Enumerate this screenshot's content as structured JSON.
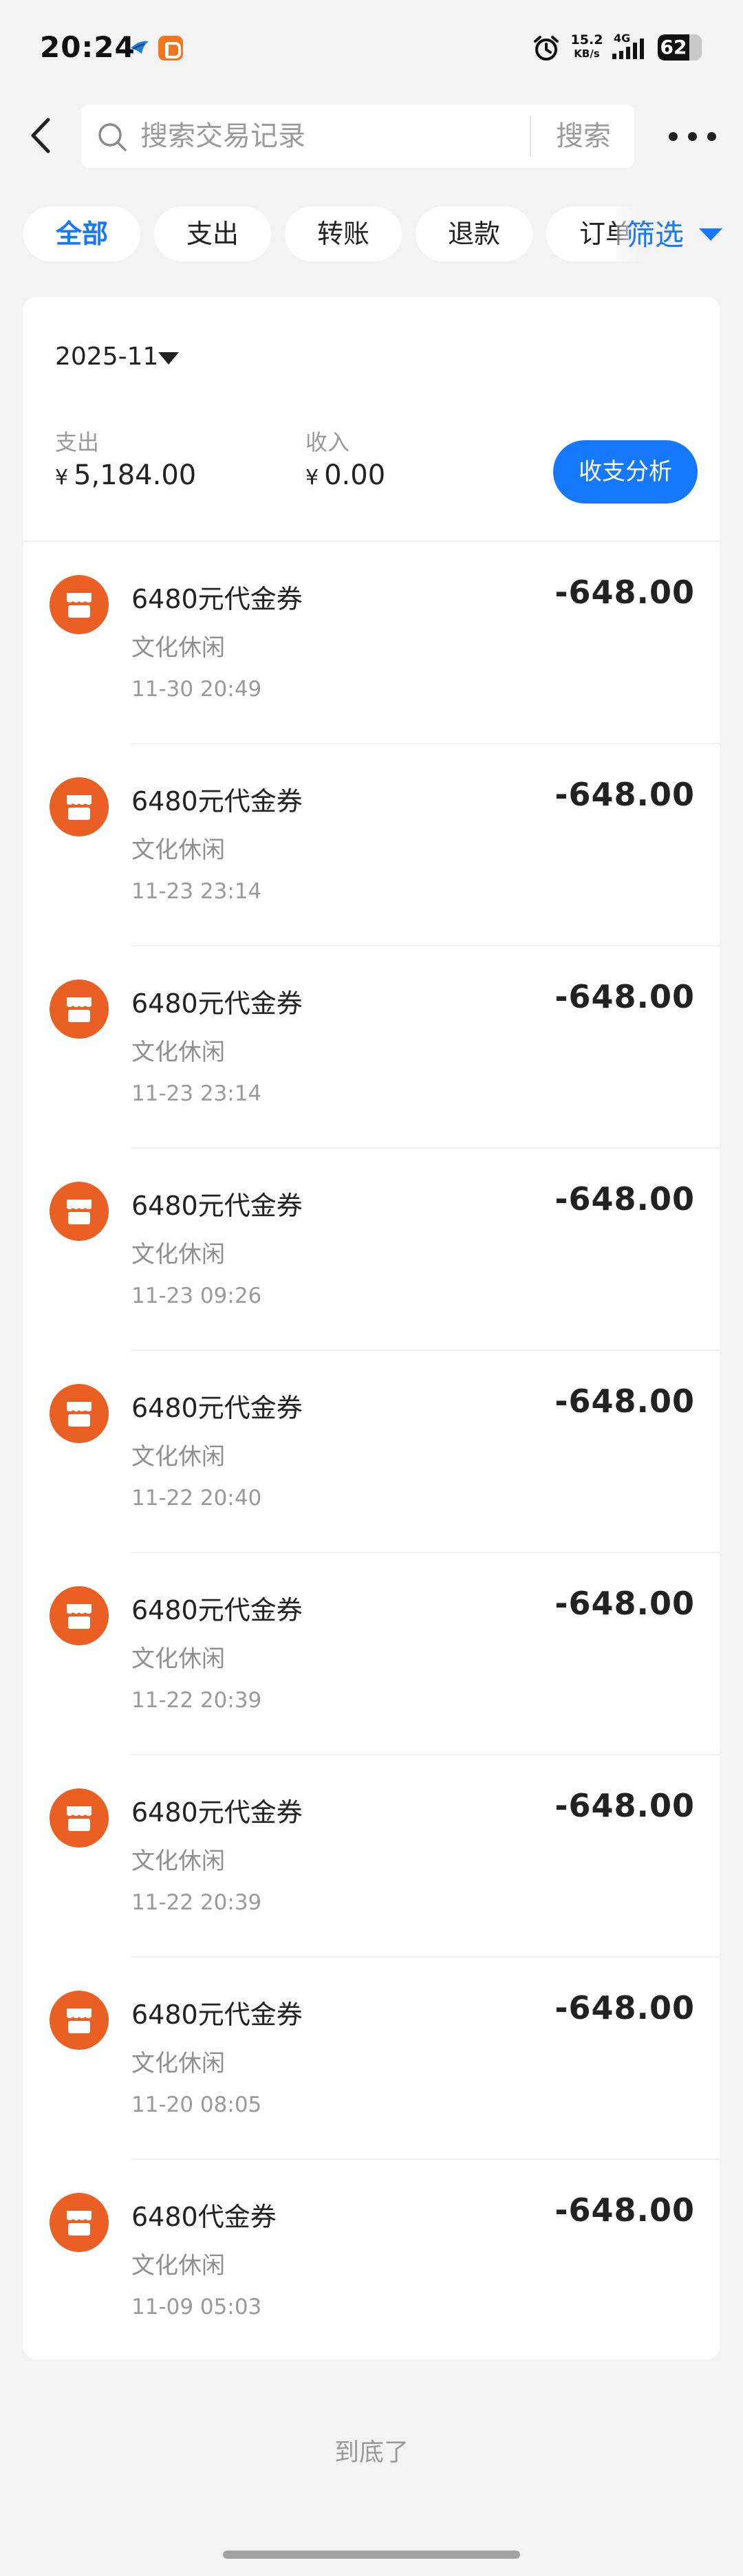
{
  "status_bar": {
    "time": "20:24",
    "net_speed_value": "15.2",
    "net_speed_unit": "KB/s",
    "network": "4G",
    "battery": "62"
  },
  "header": {
    "search_placeholder": "搜索交易记录",
    "search_button": "搜索"
  },
  "chips": [
    {
      "label": "全部",
      "active": true
    },
    {
      "label": "支出"
    },
    {
      "label": "转账"
    },
    {
      "label": "退款"
    },
    {
      "label": "订单"
    }
  ],
  "filter": {
    "label": "筛选"
  },
  "summary": {
    "month": "2025-11",
    "expense_label": "支出",
    "currency": "¥",
    "expense_value": "5,184.00",
    "income_label": "收入",
    "income_value": "0.00",
    "analysis_button": "收支分析"
  },
  "transactions": [
    {
      "title": "6480元代金券",
      "category": "文化休闲",
      "time": "11-30 20:49",
      "amount": "-648.00"
    },
    {
      "title": "6480元代金券",
      "category": "文化休闲",
      "time": "11-23 23:14",
      "amount": "-648.00"
    },
    {
      "title": "6480元代金券",
      "category": "文化休闲",
      "time": "11-23 23:14",
      "amount": "-648.00"
    },
    {
      "title": "6480元代金券",
      "category": "文化休闲",
      "time": "11-23 09:26",
      "amount": "-648.00"
    },
    {
      "title": "6480元代金券",
      "category": "文化休闲",
      "time": "11-22 20:40",
      "amount": "-648.00"
    },
    {
      "title": "6480元代金券",
      "category": "文化休闲",
      "time": "11-22 20:39",
      "amount": "-648.00"
    },
    {
      "title": "6480元代金券",
      "category": "文化休闲",
      "time": "11-22 20:39",
      "amount": "-648.00"
    },
    {
      "title": "6480元代金券",
      "category": "文化休闲",
      "time": "11-20 08:05",
      "amount": "-648.00"
    },
    {
      "title": "6480代金券",
      "category": "文化休闲",
      "time": "11-09 05:03",
      "amount": "-648.00"
    }
  ],
  "footer": {
    "end_text": "到底了"
  },
  "colors": {
    "accent": "#1677ff",
    "merchant_icon": "#ea5f24"
  },
  "icons": {
    "merchant": "shop-icon",
    "back": "chevron-left-icon",
    "search": "search-icon",
    "more": "more-dots-icon"
  }
}
